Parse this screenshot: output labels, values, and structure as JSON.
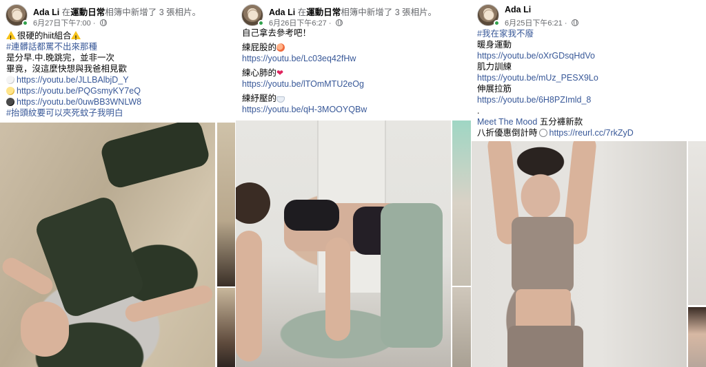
{
  "posts": [
    {
      "author": "Ada Li",
      "prefix": "在",
      "album": "運動日常",
      "action": "相簿中新增了 3 張相片。",
      "time": "6月27日下午7:00 · ",
      "lines": [
        {
          "icon": "warning-icon",
          "text": "很硬的hiit組合",
          "icon_after": "warning-icon",
          "type": "text"
        },
        {
          "text": "#連髒話都罵不出來那種",
          "type": "tag"
        },
        {
          "text": "是分早.中.晚跳完，並非一次",
          "type": "text"
        },
        {
          "text": "畢竟，沒這麼快想與我爸相見歡",
          "type": "text"
        },
        {
          "icon": "morning-moon-icon",
          "text": "https://youtu.be/JLLBAlbjD_Y",
          "type": "link"
        },
        {
          "icon": "noon-sun-icon",
          "text": "https://youtu.be/PQGsmyKY7eQ",
          "type": "link"
        },
        {
          "icon": "night-moon-icon",
          "text": "https://youtu.be/0uwBB3WNLW8",
          "type": "link"
        },
        {
          "text": "#抬頭紋要可以夾死蚊子我明白",
          "type": "tag"
        }
      ]
    },
    {
      "author": "Ada Li",
      "prefix": "在",
      "album": "運動日常",
      "action": "相簿中新增了 3 張相片。",
      "time": "6月26日下午6:27 · ",
      "lines": [
        {
          "text": "自己拿去參考吧！",
          "type": "text"
        },
        {
          "text": "練屁股的",
          "icon_after": "peach-icon",
          "type": "text"
        },
        {
          "text": "https://youtu.be/Lc03eq42fHw",
          "type": "link"
        },
        {
          "text": "練心肺的",
          "icon_after": "heart-icon",
          "type": "text"
        },
        {
          "text": "https://youtu.be/lTOmMTU2eOg",
          "type": "link"
        },
        {
          "text": "練紓壓的",
          "icon_after": "bathtub-icon",
          "type": "text"
        },
        {
          "text": "https://youtu.be/qH-3MOOYQBw",
          "type": "link"
        }
      ]
    },
    {
      "author": "Ada Li",
      "prefix": "",
      "album": "",
      "action": "",
      "time": "6月25日下午6:21 · ",
      "lines": [
        {
          "text": "#我在家我不廢",
          "type": "tag"
        },
        {
          "text": "暖身運動",
          "type": "text"
        },
        {
          "text": "https://youtu.be/oXrGDsqHdVo",
          "type": "link"
        },
        {
          "text": "肌力訓練",
          "type": "text"
        },
        {
          "text": "https://youtu.be/mUz_PESX9Lo",
          "type": "link"
        },
        {
          "text": "伸展拉筋",
          "type": "text"
        },
        {
          "text": "https://youtu.be/6H8PZImld_8",
          "type": "link"
        },
        {
          "text": ".",
          "type": "text"
        },
        {
          "text": "Meet The Mood",
          "suffix": " 五分褲新款",
          "type": "mixed"
        },
        {
          "text": "八折優惠倒計時",
          "icon_after": "alarm-clock-icon",
          "link": "https://reurl.cc/7rkZyD",
          "type": "text-link"
        }
      ]
    }
  ],
  "icons": {
    "warning-icon": "⚠",
    "heart-icon": "❤"
  },
  "colors": {
    "link": "#385898",
    "meta": "#65676b",
    "online": "#31a24c"
  }
}
